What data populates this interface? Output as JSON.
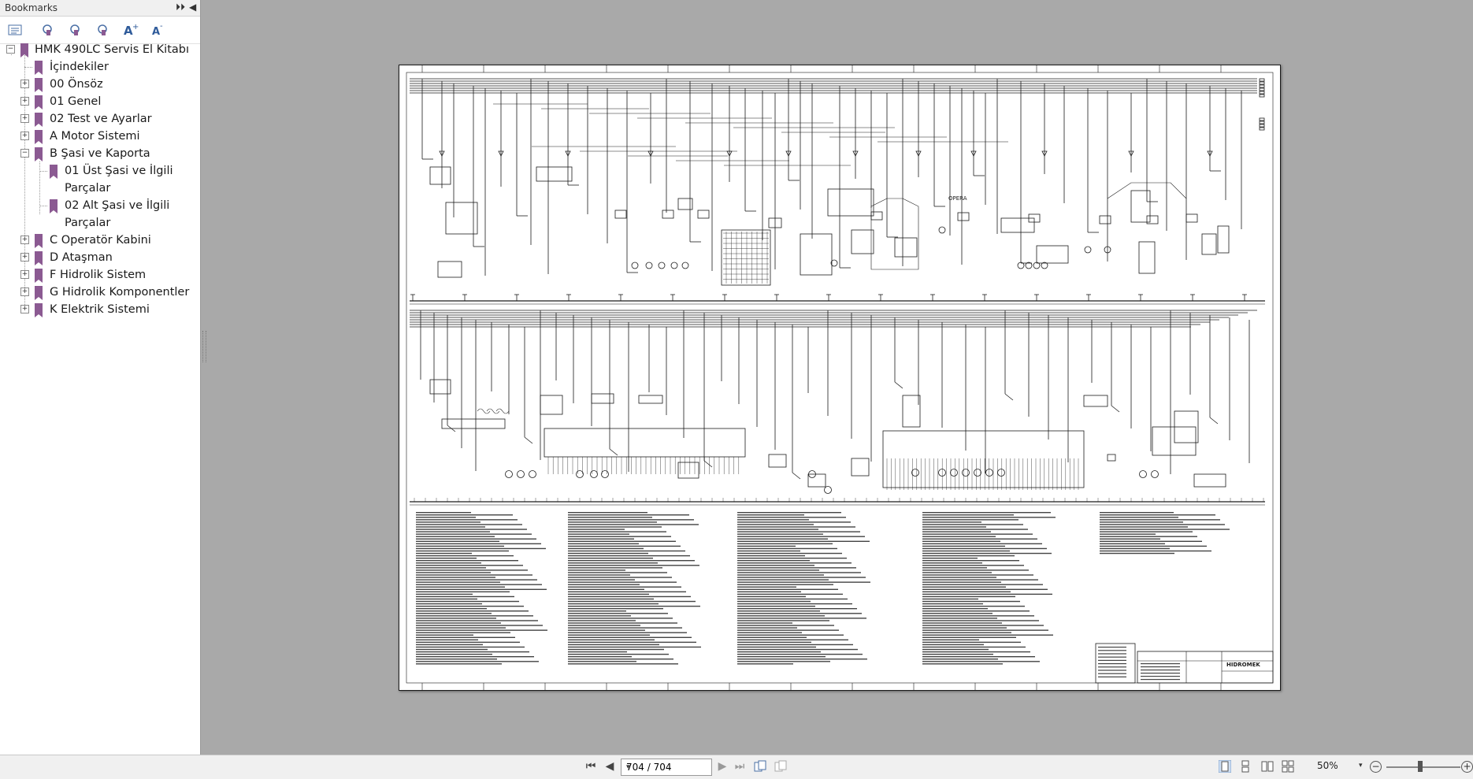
{
  "panel": {
    "title": "Bookmarks",
    "expand_glyph": "⏵⏵",
    "collapse_glyph": "◀",
    "tools": [
      "options-list-icon",
      "bookmark-expand-icon",
      "bookmark-new-icon",
      "bookmark-find-icon",
      "text-larger-icon",
      "text-smaller-icon"
    ]
  },
  "bookmarks": [
    {
      "label": "HMK 490LC Servis El Kitabı",
      "level": 0,
      "state": "open"
    },
    {
      "label": "İçindekiler",
      "level": 1,
      "state": "leaf"
    },
    {
      "label": "00 Önsöz",
      "level": 1,
      "state": "closed"
    },
    {
      "label": "01 Genel",
      "level": 1,
      "state": "closed"
    },
    {
      "label": "02 Test ve Ayarlar",
      "level": 1,
      "state": "closed"
    },
    {
      "label": "A Motor Sistemi",
      "level": 1,
      "state": "closed"
    },
    {
      "label": "B Şasi ve Kaporta",
      "level": 1,
      "state": "open"
    },
    {
      "label": "01 Üst Şasi ve İlgili",
      "label2": "Parçalar",
      "level": 2,
      "state": "leaf"
    },
    {
      "label": "02 Alt Şasi ve İlgili",
      "label2": "Parçalar",
      "level": 2,
      "state": "leaf"
    },
    {
      "label": "C Operatör Kabini",
      "level": 1,
      "state": "closed"
    },
    {
      "label": "D Ataşman",
      "level": 1,
      "state": "closed"
    },
    {
      "label": "F Hidrolik Sistem",
      "level": 1,
      "state": "closed"
    },
    {
      "label": "G Hidrolik Komponentler",
      "level": 1,
      "state": "closed"
    },
    {
      "label": "K Elektrik Sistemi",
      "level": 1,
      "state": "closed"
    }
  ],
  "document": {
    "box_label": "OPERA",
    "brand": "HIDROMEK"
  },
  "navigation": {
    "page_display": "704 / 704",
    "zoom": "50%",
    "dropdown_glyph": "▾"
  },
  "colors": {
    "bookmark": "#8b5a92",
    "workspace": "#a9a9a9",
    "panel_bg": "#ffffff",
    "toolbar_bg": "#f0f0f0",
    "drawing_ink": "#1b1b1b"
  }
}
